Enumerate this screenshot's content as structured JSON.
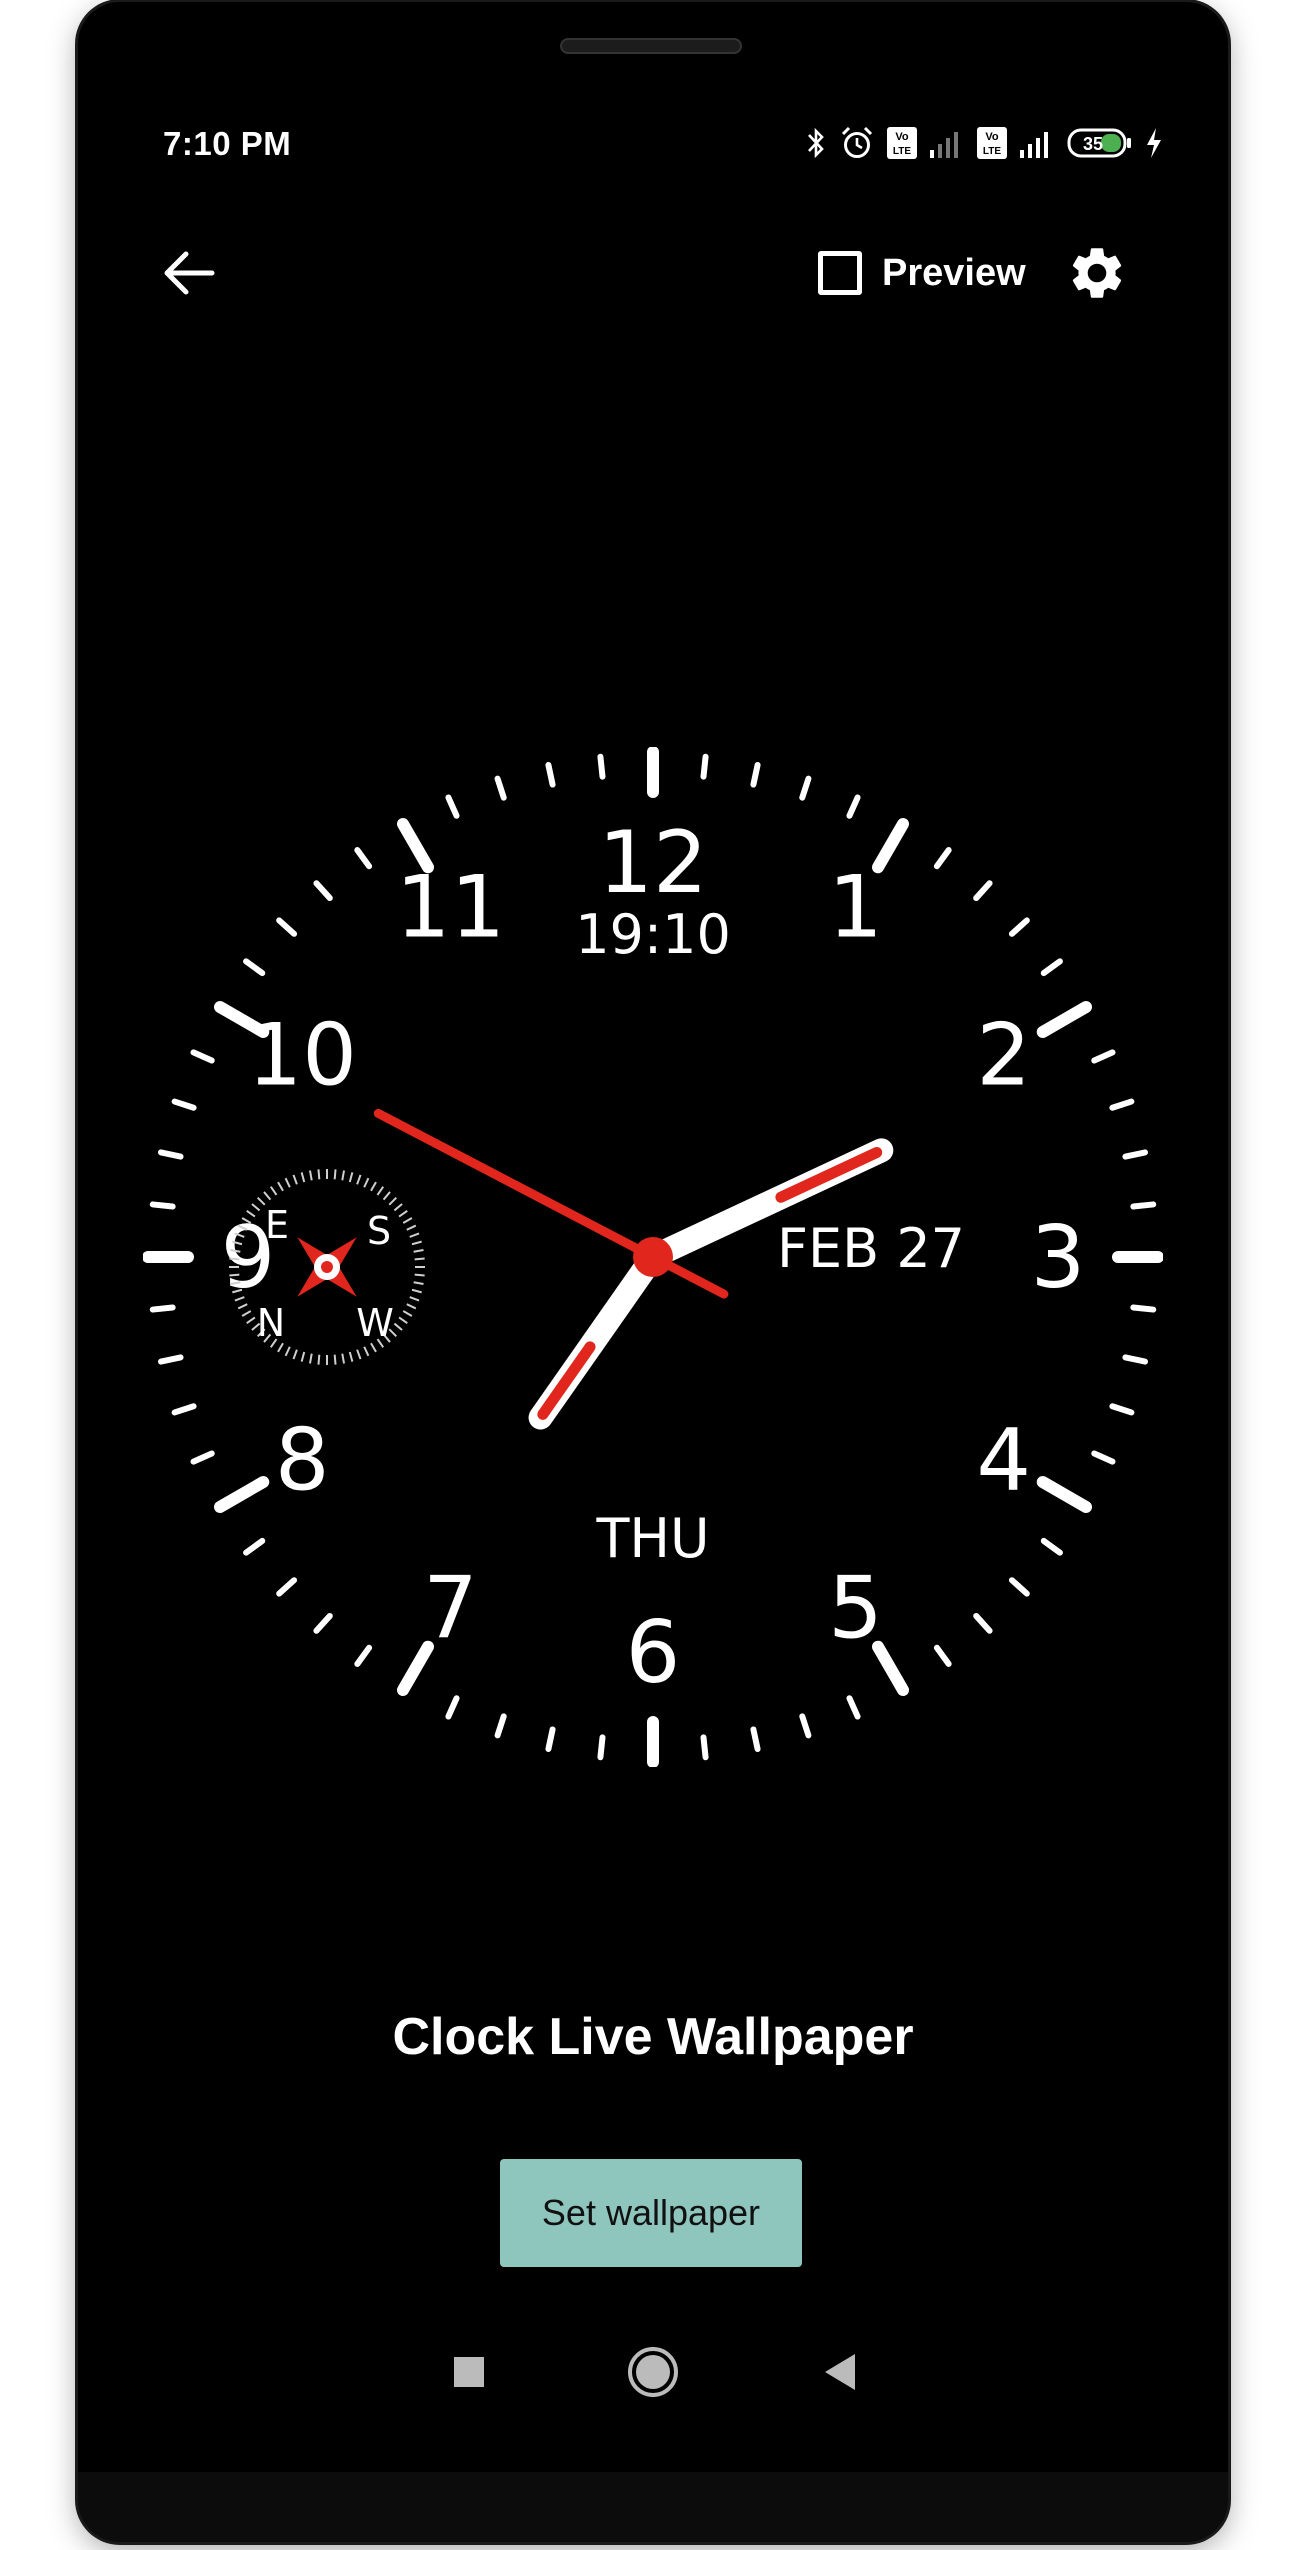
{
  "status_bar": {
    "time": "7:10 PM",
    "icons": [
      "bluetooth-icon",
      "alarm-icon",
      "volte-icon",
      "signal-icon",
      "volte-icon",
      "signal-icon",
      "battery-icon",
      "charging-icon"
    ],
    "sim_badge": "Vo\nLTE",
    "battery_level": "35"
  },
  "toolbar": {
    "back_icon": "arrow-left-icon",
    "preview_label": "Preview",
    "preview_checked": false,
    "settings_icon": "gear-icon"
  },
  "clock": {
    "numerals": [
      "12",
      "1",
      "2",
      "3",
      "4",
      "5",
      "6",
      "7",
      "8",
      "9",
      "10",
      "11"
    ],
    "digital_time": "19:10",
    "date": "FEB 27",
    "weekday": "THU",
    "compass_labels": [
      "E",
      "S",
      "N",
      "W"
    ],
    "hour": 7,
    "minute": 10,
    "second": 49.6,
    "accent_color": "#e0261d",
    "face_color": "#ffffff"
  },
  "app_title": "Clock Live Wallpaper",
  "set_button_label": "Set wallpaper",
  "colors": {
    "background": "#000000",
    "button_bg": "#8ec5bd",
    "accent": "#e0261d"
  },
  "nav": {
    "recents_icon": "square-icon",
    "home_icon": "circle-icon",
    "back_icon": "triangle-back-icon"
  }
}
